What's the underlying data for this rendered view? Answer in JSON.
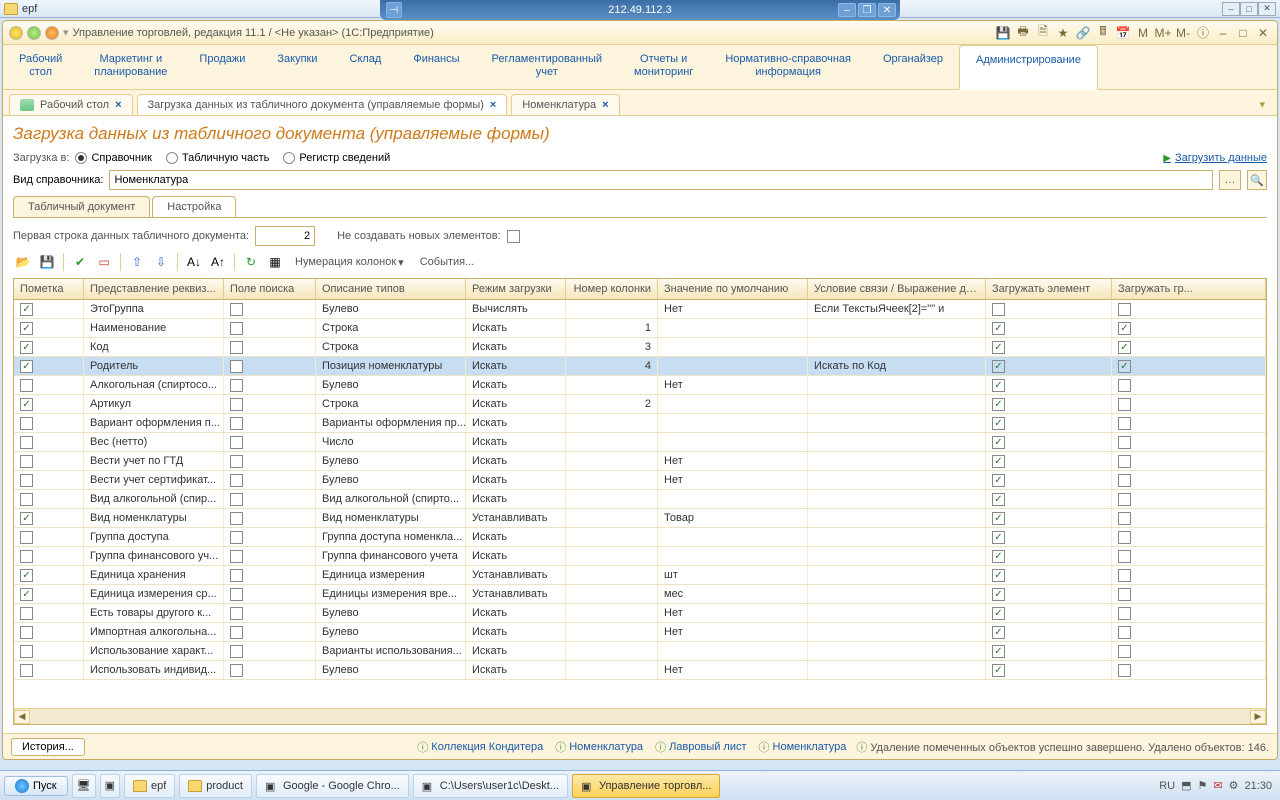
{
  "explorer": {
    "title": "epf"
  },
  "rdp": {
    "host": "212.49.112.3"
  },
  "app": {
    "title": "Управление торговлей, редакция 11.1 / <Не указан>  (1С:Предприятие)",
    "main_nav": [
      "Рабочий\nстол",
      "Маркетинг и\nпланирование",
      "Продажи",
      "Закупки",
      "Склад",
      "Финансы",
      "Регламентированный\nучет",
      "Отчеты и\nмониторинг",
      "Нормативно-справочная\nинформация",
      "Органайзер",
      "Администрирование"
    ],
    "main_nav_active": 10,
    "doc_tabs": [
      {
        "label": "Рабочий стол",
        "icon": true
      },
      {
        "label": "Загрузка данных из табличного документа (управляемые формы)",
        "active": true
      },
      {
        "label": "Номенклатура"
      }
    ],
    "page_title": "Загрузка данных из табличного документа (управляемые формы)",
    "load_into_label": "Загрузка в:",
    "radios": [
      {
        "label": "Справочник",
        "selected": true
      },
      {
        "label": "Табличную часть",
        "selected": false
      },
      {
        "label": "Регистр сведений",
        "selected": false
      }
    ],
    "run_link": "Загрузить данные",
    "catalog_label": "Вид справочника:",
    "catalog_value": "Номенклатура",
    "inner_tabs": [
      {
        "label": "Табличный документ",
        "active": false
      },
      {
        "label": "Настройка",
        "active": true
      }
    ],
    "first_row_label": "Первая строка данных табличного документа:",
    "first_row_value": "2",
    "no_new_label": "Не создавать новых элементов:",
    "tb_menu1": "Нумерация колонок",
    "tb_menu2": "События...",
    "cols": [
      "Пометка",
      "Представление реквиз...",
      "Поле поиска",
      "Описание типов",
      "Режим загрузки",
      "Номер колонки",
      "Значение по умолчанию",
      "Условие связи / Выражение дл...",
      "Загружать элемент",
      "Загружать гр..."
    ],
    "rows": [
      {
        "m": true,
        "name": "ЭтоГруппа",
        "sp": false,
        "type": "Булево",
        "mode": "Вычислять",
        "num": "",
        "def": "Нет",
        "cond": "Если   ТекстыЯчеек[2]=\"\" и",
        "le": false,
        "lg": false
      },
      {
        "m": true,
        "name": "Наименование",
        "sp": false,
        "type": "Строка",
        "mode": "Искать",
        "num": "1",
        "def": "",
        "cond": "",
        "le": true,
        "lg": true
      },
      {
        "m": true,
        "name": "Код",
        "sp": false,
        "type": "Строка",
        "mode": "Искать",
        "num": "3",
        "def": "",
        "cond": "",
        "le": true,
        "lg": true
      },
      {
        "m": true,
        "name": "Родитель",
        "sp": false,
        "type": "Позиция номенклатуры",
        "mode": "Искать",
        "num": "4",
        "def": "",
        "cond": "Искать по Код",
        "le": true,
        "lg": true,
        "sel": true
      },
      {
        "m": false,
        "name": "Алкогольная (спиртосо...",
        "sp": false,
        "type": "Булево",
        "mode": "Искать",
        "num": "",
        "def": "Нет",
        "cond": "",
        "le": true,
        "lg": false
      },
      {
        "m": true,
        "name": "Артикул",
        "sp": false,
        "type": "Строка",
        "mode": "Искать",
        "num": "2",
        "def": "",
        "cond": "",
        "le": true,
        "lg": false
      },
      {
        "m": false,
        "name": "Вариант оформления п...",
        "sp": false,
        "type": "Варианты оформления пр...",
        "mode": "Искать",
        "num": "",
        "def": "",
        "cond": "",
        "le": true,
        "lg": false
      },
      {
        "m": false,
        "name": "Вес (нетто)",
        "sp": false,
        "type": "Число",
        "mode": "Искать",
        "num": "",
        "def": "",
        "cond": "",
        "le": true,
        "lg": false
      },
      {
        "m": false,
        "name": "Вести учет по ГТД",
        "sp": false,
        "type": "Булево",
        "mode": "Искать",
        "num": "",
        "def": "Нет",
        "cond": "",
        "le": true,
        "lg": false
      },
      {
        "m": false,
        "name": "Вести учет сертификат...",
        "sp": false,
        "type": "Булево",
        "mode": "Искать",
        "num": "",
        "def": "Нет",
        "cond": "",
        "le": true,
        "lg": false
      },
      {
        "m": false,
        "name": "Вид алкогольной (спир...",
        "sp": false,
        "type": "Вид алкогольной (спирто...",
        "mode": "Искать",
        "num": "",
        "def": "",
        "cond": "",
        "le": true,
        "lg": false
      },
      {
        "m": true,
        "name": "Вид номенклатуры",
        "sp": false,
        "type": "Вид номенклатуры",
        "mode": "Устанавливать",
        "num": "",
        "def": "Товар",
        "cond": "",
        "le": true,
        "lg": false
      },
      {
        "m": false,
        "name": "Группа доступа",
        "sp": false,
        "type": "Группа доступа номенкла...",
        "mode": "Искать",
        "num": "",
        "def": "",
        "cond": "",
        "le": true,
        "lg": false
      },
      {
        "m": false,
        "name": "Группа финансового уч...",
        "sp": false,
        "type": "Группа финансового учета",
        "mode": "Искать",
        "num": "",
        "def": "",
        "cond": "",
        "le": true,
        "lg": false
      },
      {
        "m": true,
        "name": "Единица хранения",
        "sp": false,
        "type": "Единица измерения",
        "mode": "Устанавливать",
        "num": "",
        "def": "шт",
        "cond": "",
        "le": true,
        "lg": false
      },
      {
        "m": true,
        "name": "Единица измерения ср...",
        "sp": false,
        "type": "Единицы измерения вре...",
        "mode": "Устанавливать",
        "num": "",
        "def": "мес",
        "cond": "",
        "le": true,
        "lg": false
      },
      {
        "m": false,
        "name": "Есть товары другого к...",
        "sp": false,
        "type": "Булево",
        "mode": "Искать",
        "num": "",
        "def": "Нет",
        "cond": "",
        "le": true,
        "lg": false
      },
      {
        "m": false,
        "name": "Импортная алкогольна...",
        "sp": false,
        "type": "Булево",
        "mode": "Искать",
        "num": "",
        "def": "Нет",
        "cond": "",
        "le": true,
        "lg": false
      },
      {
        "m": false,
        "name": "Использование характ...",
        "sp": false,
        "type": "Варианты использования...",
        "mode": "Искать",
        "num": "",
        "def": "",
        "cond": "",
        "le": true,
        "lg": false
      },
      {
        "m": false,
        "name": "Использовать индивид...",
        "sp": false,
        "type": "Булево",
        "mode": "Искать",
        "num": "",
        "def": "Нет",
        "cond": "",
        "le": true,
        "lg": false
      }
    ],
    "history_btn": "История...",
    "bottom_links": [
      "Коллекция Кондитера",
      "Номенклатура",
      "Лавровый лист",
      "Номенклатура"
    ],
    "status_msg": "Удаление помеченных объектов успешно завершено. Удалено объектов: 146."
  },
  "taskbar": {
    "start": "Пуск",
    "items": [
      {
        "label": "epf",
        "folder": true
      },
      {
        "label": "product",
        "folder": true
      },
      {
        "label": "Google - Google Chro..."
      },
      {
        "label": "C:\\Users\\user1c\\Deskt..."
      },
      {
        "label": "Управление торговл...",
        "active": true
      }
    ],
    "lang": "RU",
    "time": "21:30"
  }
}
